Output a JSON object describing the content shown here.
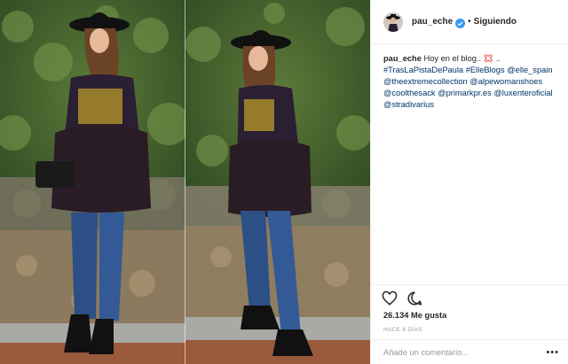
{
  "author": {
    "username": "pau_eche",
    "verified": true,
    "follow_state": "Siguiendo"
  },
  "caption": {
    "author": "pau_eche",
    "text": "Hoy en el blog.. 💢 ..",
    "tags": [
      "#TrasLaPistaDePaula",
      "#ElleBlogs",
      "@elle_spain",
      "@theextremecollection",
      "@alpewomanshoes",
      "@coolthesack",
      "@primarkpr.es",
      "@luxenteroficial",
      "@stradivarius"
    ]
  },
  "stats": {
    "likes": "26.134 Me gusta",
    "time_ago": "HACE 4 DÍAS"
  },
  "comment": {
    "placeholder": "Añade un comentario...",
    "more": "•••"
  },
  "icons": {
    "like": "heart-icon",
    "comment": "comment-icon",
    "verified": "verified-badge-icon",
    "more": "more-options-icon"
  },
  "colors": {
    "link": "#003569",
    "verified": "#3897f0",
    "text": "#262626",
    "muted": "#999999"
  }
}
